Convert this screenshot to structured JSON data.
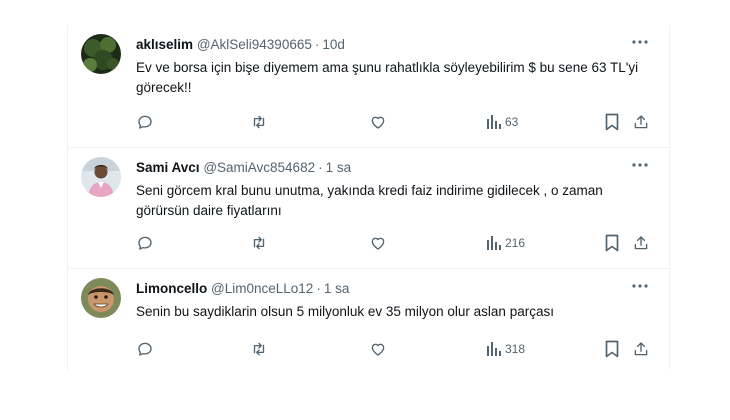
{
  "tweets": [
    {
      "display_name": "aklıselim",
      "handle": "@AklSeli94390665",
      "separator": "·",
      "time": "10d",
      "text": "Ev ve borsa için bişe diyemem ama şunu rahatlıkla söyleyebilirim $ bu sene 63 TL'yi görecek!!",
      "views": "63"
    },
    {
      "display_name": "Sami Avcı",
      "handle": "@SamiAvc854682",
      "separator": "·",
      "time": "1 sa",
      "text": "Seni görcem kral bunu unutma, yakında kredi faiz indirime gidilecek , o zaman görürsün daire fiyatlarını",
      "views": "216"
    },
    {
      "display_name": "Limoncello",
      "handle": "@Lim0nceLLo12",
      "separator": "·",
      "time": "1 sa",
      "text": "Senin bu saydiklarin olsun 5 milyonluk ev 35 milyon olur aslan parçası",
      "views": "318"
    }
  ],
  "icons": {
    "more": "more-horizontal-icon",
    "reply": "reply-icon",
    "retweet": "retweet-icon",
    "like": "heart-icon",
    "views": "views-bar-chart-icon",
    "bookmark": "bookmark-icon",
    "share": "share-icon"
  },
  "colors": {
    "text_primary": "#0f1419",
    "text_secondary": "#536471",
    "divider": "#eff3f4"
  }
}
